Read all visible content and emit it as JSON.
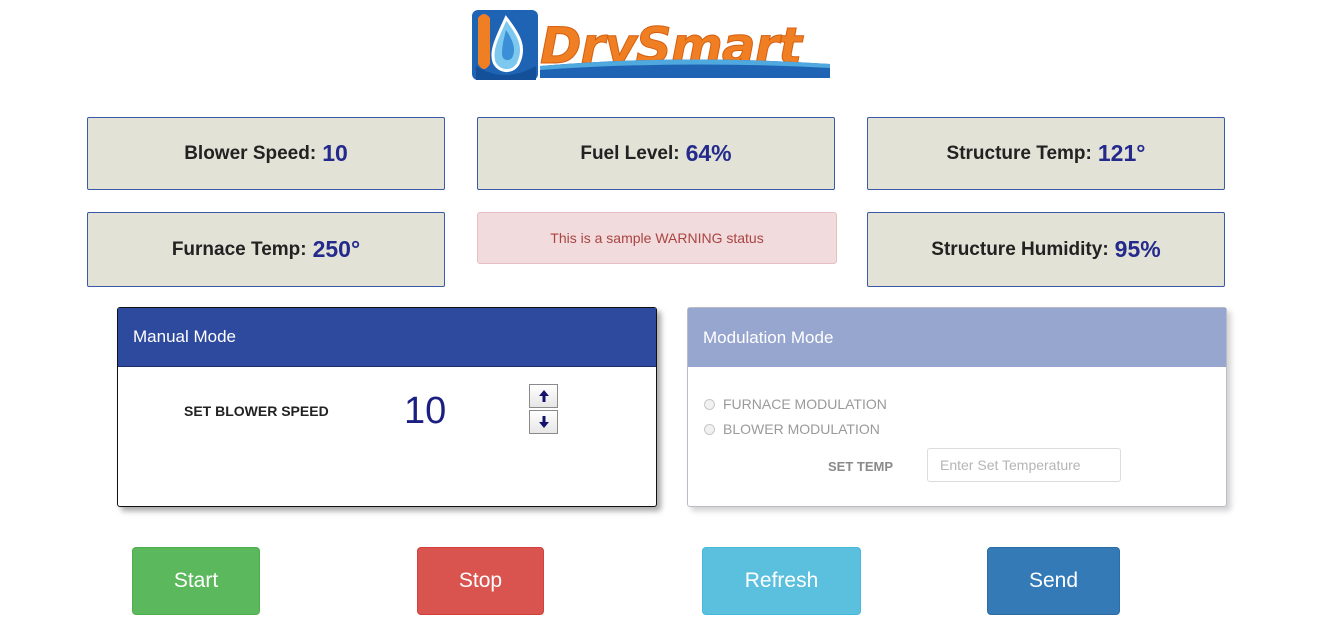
{
  "logo": {
    "text": "DrySmart",
    "colors": {
      "orange": "#f07e22",
      "blue": "#1f64b4",
      "lightblue": "#4fa8de"
    }
  },
  "stats": {
    "blower_speed": {
      "label": "Blower Speed:",
      "value": "10"
    },
    "fuel_level": {
      "label": "Fuel Level:",
      "value": "64%"
    },
    "structure_temp": {
      "label": "Structure Temp:",
      "value": "121°"
    },
    "furnace_temp": {
      "label": "Furnace Temp:",
      "value": "250°"
    },
    "structure_humidity": {
      "label": "Structure Humidity:",
      "value": "95%"
    }
  },
  "warning": {
    "text": "This is a sample WARNING status"
  },
  "manual_mode": {
    "title": "Manual Mode",
    "set_blower_label": "SET BLOWER SPEED",
    "blower_value": "10",
    "up_icon": "arrow-up-icon",
    "down_icon": "arrow-down-icon"
  },
  "modulation_mode": {
    "title": "Modulation Mode",
    "options": [
      {
        "label": "FURNACE MODULATION",
        "selected": false
      },
      {
        "label": "BLOWER MODULATION",
        "selected": false
      }
    ],
    "set_temp_label": "SET TEMP",
    "set_temp_placeholder": "Enter Set Temperature",
    "set_temp_value": ""
  },
  "actions": {
    "start": "Start",
    "stop": "Stop",
    "refresh": "Refresh",
    "send": "Send"
  },
  "colors": {
    "stat_bg": "#e3e2d6",
    "value_text": "#232a8c",
    "manual_header": "#2e4a9e",
    "modulation_header": "#97a6cf",
    "warning_bg": "#f2dbdc",
    "warning_text": "#a94442",
    "start": "#5cb85c",
    "stop": "#d9534f",
    "refresh": "#5bc0de",
    "send": "#337ab7"
  }
}
